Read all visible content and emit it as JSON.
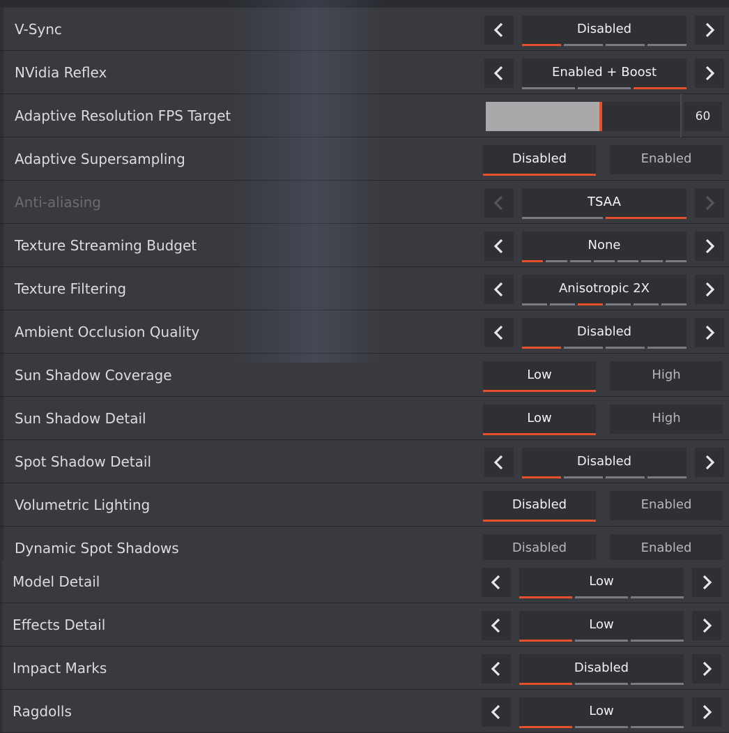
{
  "colors": {
    "accent": "#e5512a",
    "row_bg": "#393a3f",
    "control_bg": "#2f3034"
  },
  "icons": {
    "left": "chevron-left-icon",
    "right": "chevron-right-icon"
  },
  "rows": [
    {
      "label": "V-Sync",
      "type": "carousel",
      "value": "Disabled",
      "segments": 4,
      "selected": 0
    },
    {
      "label": "NVidia Reflex",
      "type": "carousel",
      "value": "Enabled + Boost",
      "segments": 3,
      "selected": 2
    },
    {
      "label": "Adaptive Resolution FPS Target",
      "type": "slider",
      "value": "60",
      "fill_fraction": 0.59
    },
    {
      "label": "Adaptive Supersampling",
      "type": "toggle",
      "options": [
        "Disabled",
        "Enabled"
      ],
      "selected": 0
    },
    {
      "label": "Anti-aliasing",
      "type": "carousel",
      "value": "TSAA",
      "segments": 2,
      "selected": 1,
      "disabled": true
    },
    {
      "label": "Texture Streaming Budget",
      "type": "carousel",
      "value": "None",
      "segments": 7,
      "selected": 0
    },
    {
      "label": "Texture Filtering",
      "type": "carousel",
      "value": "Anisotropic 2X",
      "segments": 6,
      "selected": 2
    },
    {
      "label": "Ambient Occlusion Quality",
      "type": "carousel",
      "value": "Disabled",
      "segments": 4,
      "selected": 0
    },
    {
      "label": "Sun Shadow Coverage",
      "type": "toggle",
      "options": [
        "Low",
        "High"
      ],
      "selected": 0
    },
    {
      "label": "Sun Shadow Detail",
      "type": "toggle",
      "options": [
        "Low",
        "High"
      ],
      "selected": 0
    },
    {
      "label": "Spot Shadow Detail",
      "type": "carousel",
      "value": "Disabled",
      "segments": 4,
      "selected": 0
    },
    {
      "label": "Volumetric Lighting",
      "type": "toggle",
      "options": [
        "Disabled",
        "Enabled"
      ],
      "selected": 0
    },
    {
      "label": "Dynamic Spot Shadows",
      "type": "toggle",
      "options": [
        "Disabled",
        "Enabled"
      ],
      "selected": -1
    },
    {
      "label": "Model Detail",
      "type": "carousel",
      "value": "Low",
      "segments": 3,
      "selected": 0
    },
    {
      "label": "Effects Detail",
      "type": "carousel",
      "value": "Low",
      "segments": 3,
      "selected": 0
    },
    {
      "label": "Impact Marks",
      "type": "carousel",
      "value": "Disabled",
      "segments": 3,
      "selected": 0
    },
    {
      "label": "Ragdolls",
      "type": "carousel",
      "value": "Low",
      "segments": 3,
      "selected": 0
    }
  ]
}
